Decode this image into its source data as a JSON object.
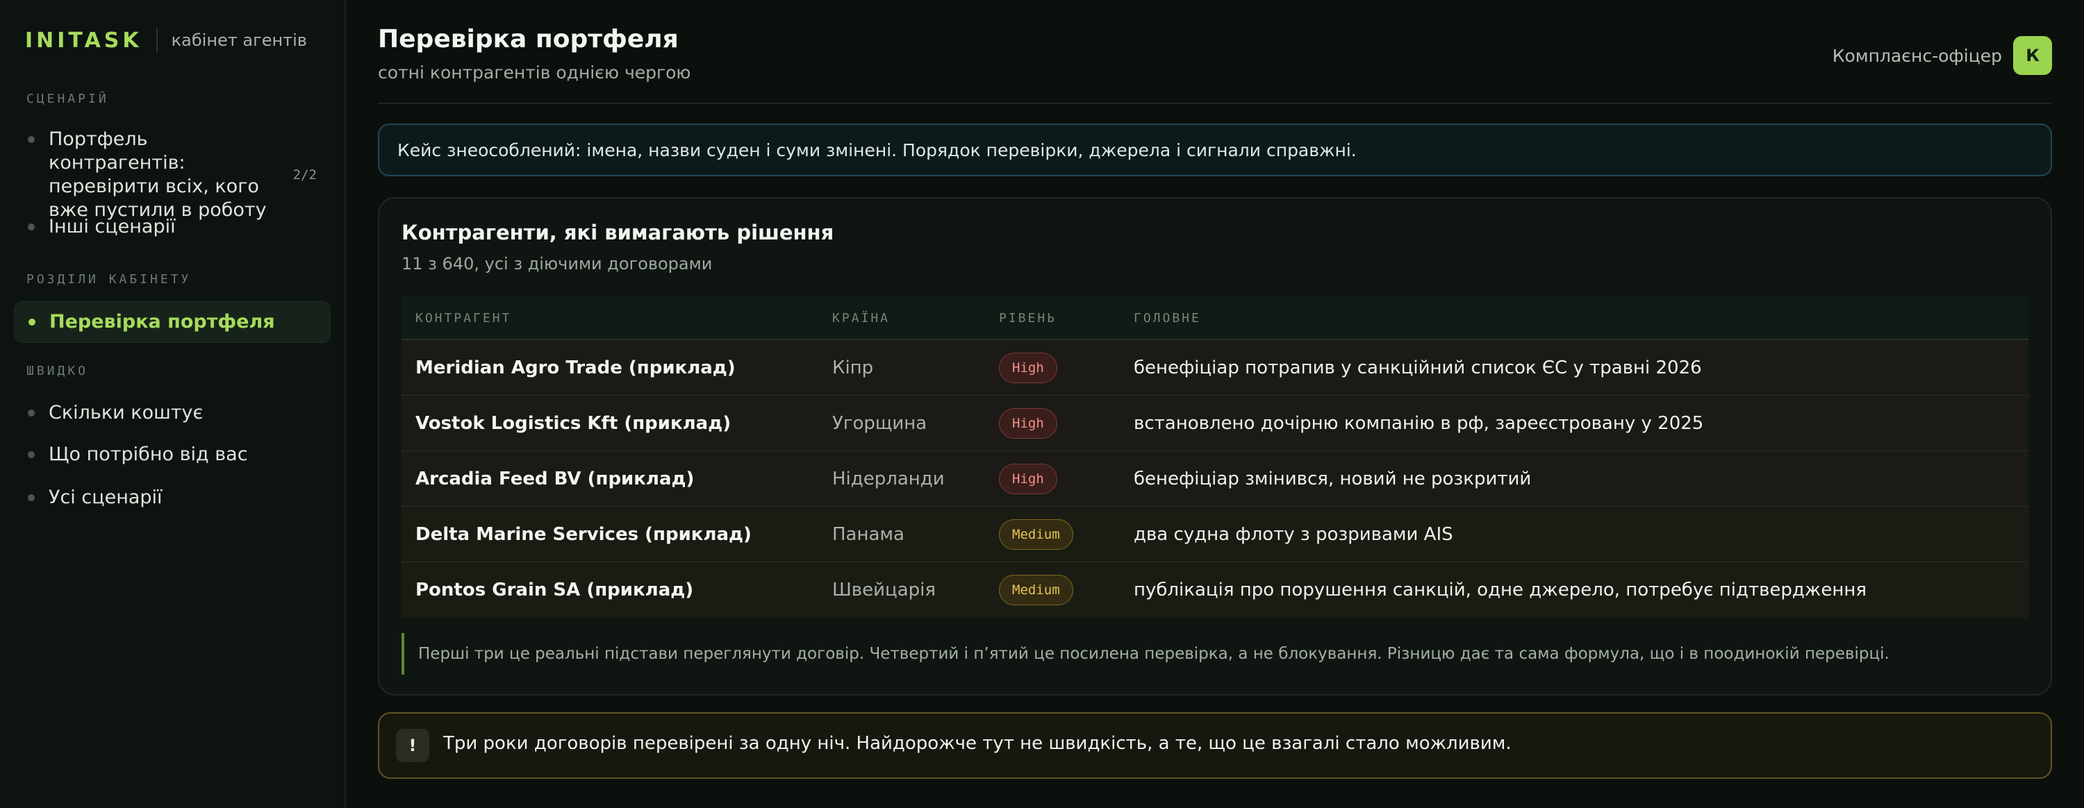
{
  "brand": {
    "logo": "INITASK",
    "subtitle": "кабінет агентів"
  },
  "sidebar": {
    "scenarios_label": "СЦЕНАРІЙ",
    "scenarios": [
      {
        "label": "Портфель контрагентів: перевірити всіх, кого вже пустили в роботу",
        "count": "2/2"
      },
      {
        "label": "Інші сценарії"
      }
    ],
    "sections_label": "РОЗДІЛИ КАБІНЕТУ",
    "sections": [
      {
        "label": "Перевірка портфеля",
        "active": true
      }
    ],
    "quick_label": "ШВИДКО",
    "quick": [
      {
        "label": "Скільки коштує"
      },
      {
        "label": "Що потрібно від вас"
      },
      {
        "label": "Усі сценарії"
      }
    ]
  },
  "header": {
    "title": "Перевірка портфеля",
    "subtitle": "сотні контрагентів однією чергою",
    "user_role": "Комплаєнс-офіцер",
    "avatar_letter": "К"
  },
  "notice": "Кейс знеособлений: імена, назви суден і суми змінені. Порядок перевірки, джерела і сигнали справжні.",
  "card": {
    "title": "Контрагенти, які вимагають рішення",
    "subtitle": "11 з 640, усі з діючими договорами",
    "columns": [
      "КОНТРАГЕНТ",
      "КРАЇНА",
      "РІВЕНЬ",
      "ГОЛОВНЕ"
    ],
    "rows": [
      {
        "name": "Meridian Agro Trade (приклад)",
        "country": "Кіпр",
        "level": "High",
        "main": "бенефіціар потрапив у санкційний список ЄС у травні 2026"
      },
      {
        "name": "Vostok Logistics Kft (приклад)",
        "country": "Угорщина",
        "level": "High",
        "main": "встановлено дочірню компанію в рф, зареєстровану у 2025"
      },
      {
        "name": "Arcadia Feed BV (приклад)",
        "country": "Нідерланди",
        "level": "High",
        "main": "бенефіціар змінився, новий не розкритий"
      },
      {
        "name": "Delta Marine Services (приклад)",
        "country": "Панама",
        "level": "Medium",
        "main": "два судна флоту з розривами AIS"
      },
      {
        "name": "Pontos Grain SA (приклад)",
        "country": "Швейцарія",
        "level": "Medium",
        "main": "публікація про порушення санкцій, одне джерело, потребує підтвердження"
      }
    ],
    "note": "Перші три це реальні підстави переглянути договір. Четвертий і п’ятий це посилена перевірка, а не блокування. Різницю дає та сама формула, що і в поодинокій перевірці."
  },
  "alert": {
    "icon": "!",
    "text": "Три роки договорів перевірені за одну ніч. Найдорожче тут не швидкість, а те, що це взагалі стало можливим."
  },
  "colors": {
    "accent": "#a6db5c",
    "high": "#f0928a",
    "medium": "#e5c35a"
  }
}
